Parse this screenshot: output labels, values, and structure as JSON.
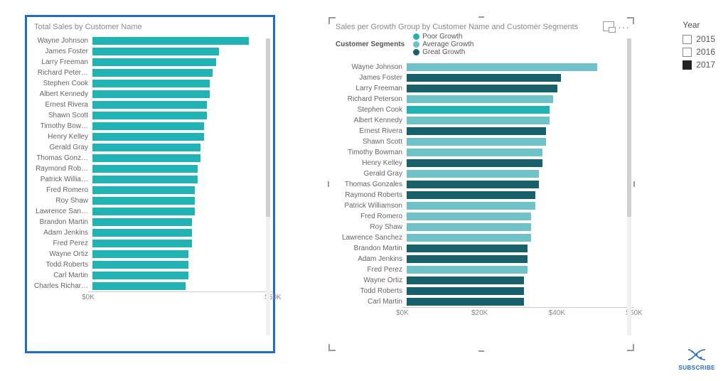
{
  "colors": {
    "poor": "#21b2b3",
    "average": "#6fc3c8",
    "great": "#17606c"
  },
  "slicer": {
    "title": "Year",
    "options": [
      {
        "label": "2015",
        "selected": false
      },
      {
        "label": "2016",
        "selected": false
      },
      {
        "label": "2017",
        "selected": true
      }
    ]
  },
  "subscribe": {
    "label": "SUBSCRIBE"
  },
  "chartL": {
    "title": "Total Sales by Customer Name",
    "xticks": [
      "$0K",
      "$50K"
    ],
    "xmax": 60,
    "bar_color_key": "poor",
    "data": [
      {
        "name": "Wayne Johnson",
        "value": 52
      },
      {
        "name": "James Foster",
        "value": 42
      },
      {
        "name": "Larry Freeman",
        "value": 41
      },
      {
        "name": "Richard Peter…",
        "value": 40
      },
      {
        "name": "Stephen Cook",
        "value": 39
      },
      {
        "name": "Albert Kennedy",
        "value": 39
      },
      {
        "name": "Ernest Rivera",
        "value": 38
      },
      {
        "name": "Shawn Scott",
        "value": 38
      },
      {
        "name": "Timothy Bow…",
        "value": 37
      },
      {
        "name": "Henry Kelley",
        "value": 37
      },
      {
        "name": "Gerald Gray",
        "value": 36
      },
      {
        "name": "Thomas Gonz…",
        "value": 36
      },
      {
        "name": "Raymond Rob…",
        "value": 35
      },
      {
        "name": "Patrick Willia…",
        "value": 35
      },
      {
        "name": "Fred Romero",
        "value": 34
      },
      {
        "name": "Roy Shaw",
        "value": 34
      },
      {
        "name": "Lawrence San…",
        "value": 34
      },
      {
        "name": "Brandon Martin",
        "value": 33
      },
      {
        "name": "Adam Jenkins",
        "value": 33
      },
      {
        "name": "Fred Perez",
        "value": 33
      },
      {
        "name": "Wayne Ortiz",
        "value": 32
      },
      {
        "name": "Todd Roberts",
        "value": 32
      },
      {
        "name": "Carl Martin",
        "value": 32
      },
      {
        "name": "Charles Richar…",
        "value": 31
      }
    ]
  },
  "chartR": {
    "title": "Sales per Growth Group by Customer Name and Customer Segments",
    "legend_title": "Customer Segments",
    "series": [
      {
        "name": "Poor Growth",
        "color_key": "poor"
      },
      {
        "name": "Average Growth",
        "color_key": "average"
      },
      {
        "name": "Great Growth",
        "color_key": "great"
      }
    ],
    "xticks": [
      "$0K",
      "$20K",
      "$40K",
      "$60K"
    ],
    "xmax": 62,
    "data": [
      {
        "name": "Wayne Johnson",
        "value": 52,
        "seg": "average"
      },
      {
        "name": "James Foster",
        "value": 42,
        "seg": "great"
      },
      {
        "name": "Larry Freeman",
        "value": 41,
        "seg": "great"
      },
      {
        "name": "Richard Peterson",
        "value": 40,
        "seg": "average"
      },
      {
        "name": "Stephen Cook",
        "value": 39,
        "seg": "poor"
      },
      {
        "name": "Albert Kennedy",
        "value": 39,
        "seg": "average"
      },
      {
        "name": "Ernest Rivera",
        "value": 38,
        "seg": "great"
      },
      {
        "name": "Shawn Scott",
        "value": 38,
        "seg": "average"
      },
      {
        "name": "Timothy Bowman",
        "value": 37,
        "seg": "average"
      },
      {
        "name": "Henry Kelley",
        "value": 37,
        "seg": "great"
      },
      {
        "name": "Gerald Gray",
        "value": 36,
        "seg": "average"
      },
      {
        "name": "Thomas Gonzales",
        "value": 36,
        "seg": "great"
      },
      {
        "name": "Raymond Roberts",
        "value": 35,
        "seg": "great"
      },
      {
        "name": "Patrick Williamson",
        "value": 35,
        "seg": "average"
      },
      {
        "name": "Fred Romero",
        "value": 34,
        "seg": "average"
      },
      {
        "name": "Roy Shaw",
        "value": 34,
        "seg": "average"
      },
      {
        "name": "Lawrence Sanchez",
        "value": 34,
        "seg": "average"
      },
      {
        "name": "Brandon Martin",
        "value": 33,
        "seg": "great"
      },
      {
        "name": "Adam Jenkins",
        "value": 33,
        "seg": "great"
      },
      {
        "name": "Fred Perez",
        "value": 33,
        "seg": "average"
      },
      {
        "name": "Wayne Ortiz",
        "value": 32,
        "seg": "great"
      },
      {
        "name": "Todd Roberts",
        "value": 32,
        "seg": "great"
      },
      {
        "name": "Carl Martin",
        "value": 32,
        "seg": "great"
      }
    ]
  },
  "chart_data": [
    {
      "type": "bar",
      "orientation": "horizontal",
      "title": "Total Sales by Customer Name",
      "xlabel": "",
      "ylabel": "",
      "xlim": [
        0,
        60
      ],
      "xtick_labels": [
        "$0K",
        "$50K"
      ],
      "categories": [
        "Wayne Johnson",
        "James Foster",
        "Larry Freeman",
        "Richard Peterson",
        "Stephen Cook",
        "Albert Kennedy",
        "Ernest Rivera",
        "Shawn Scott",
        "Timothy Bowman",
        "Henry Kelley",
        "Gerald Gray",
        "Thomas Gonzales",
        "Raymond Roberts",
        "Patrick Williamson",
        "Fred Romero",
        "Roy Shaw",
        "Lawrence Sanchez",
        "Brandon Martin",
        "Adam Jenkins",
        "Fred Perez",
        "Wayne Ortiz",
        "Todd Roberts",
        "Carl Martin",
        "Charles Richardson"
      ],
      "values": [
        52,
        42,
        41,
        40,
        39,
        39,
        38,
        38,
        37,
        37,
        36,
        36,
        35,
        35,
        34,
        34,
        34,
        33,
        33,
        33,
        32,
        32,
        32,
        31
      ]
    },
    {
      "type": "bar",
      "orientation": "horizontal",
      "title": "Sales per Growth Group by Customer Name and Customer Segments",
      "xlabel": "",
      "ylabel": "",
      "xlim": [
        0,
        62
      ],
      "xtick_labels": [
        "$0K",
        "$20K",
        "$40K",
        "$60K"
      ],
      "legend": [
        "Poor Growth",
        "Average Growth",
        "Great Growth"
      ],
      "categories": [
        "Wayne Johnson",
        "James Foster",
        "Larry Freeman",
        "Richard Peterson",
        "Stephen Cook",
        "Albert Kennedy",
        "Ernest Rivera",
        "Shawn Scott",
        "Timothy Bowman",
        "Henry Kelley",
        "Gerald Gray",
        "Thomas Gonzales",
        "Raymond Roberts",
        "Patrick Williamson",
        "Fred Romero",
        "Roy Shaw",
        "Lawrence Sanchez",
        "Brandon Martin",
        "Adam Jenkins",
        "Fred Perez",
        "Wayne Ortiz",
        "Todd Roberts",
        "Carl Martin"
      ],
      "values": [
        52,
        42,
        41,
        40,
        39,
        39,
        38,
        38,
        37,
        37,
        36,
        36,
        35,
        35,
        34,
        34,
        34,
        33,
        33,
        33,
        32,
        32,
        32
      ],
      "segment": [
        "Average Growth",
        "Great Growth",
        "Great Growth",
        "Average Growth",
        "Poor Growth",
        "Average Growth",
        "Great Growth",
        "Average Growth",
        "Average Growth",
        "Great Growth",
        "Average Growth",
        "Great Growth",
        "Great Growth",
        "Average Growth",
        "Average Growth",
        "Average Growth",
        "Average Growth",
        "Great Growth",
        "Great Growth",
        "Average Growth",
        "Great Growth",
        "Great Growth",
        "Great Growth"
      ]
    }
  ]
}
